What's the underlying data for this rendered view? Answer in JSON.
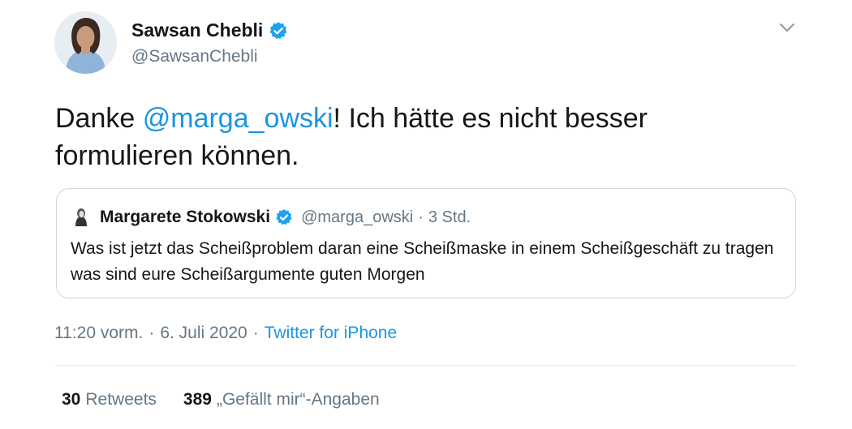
{
  "author": {
    "display_name": "Sawsan Chebli",
    "handle": "@SawsanChebli"
  },
  "tweet": {
    "text_before": "Danke ",
    "mention": "@marga_owski",
    "text_after": "! Ich hätte es nicht besser formulieren können."
  },
  "quoted": {
    "display_name": "Margarete Stokowski",
    "handle": "@marga_owski",
    "separator": "·",
    "time": "3 Std.",
    "text": "Was ist jetzt das Scheißproblem daran eine Scheißmaske in einem Scheißgeschäft zu tragen was sind eure Scheißargumente guten Morgen"
  },
  "meta": {
    "time": "11:20 vorm.",
    "separator1": "·",
    "date": "6. Juli 2020",
    "separator2": "·",
    "source": "Twitter for iPhone"
  },
  "stats": {
    "retweets_count": "30",
    "retweets_label": "Retweets",
    "likes_count": "389",
    "likes_label": "„Gefällt mir“-Angaben"
  },
  "icons": {
    "verified": "verified-badge-icon",
    "menu": "chevron-down-icon"
  },
  "colors": {
    "link": "#1b95e0",
    "secondary": "#657786",
    "border": "#ccd6dd"
  }
}
